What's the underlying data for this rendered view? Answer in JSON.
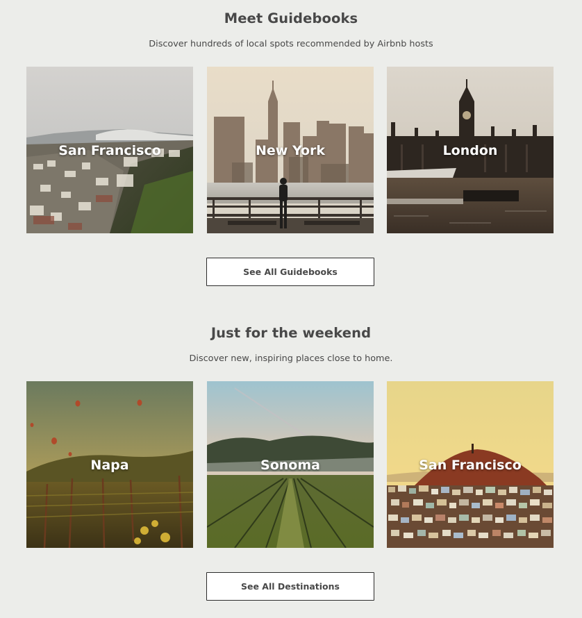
{
  "guidebooks": {
    "title": "Meet Guidebooks",
    "subtitle": "Discover hundreds of local spots recommended by Airbnb hosts",
    "cards": [
      {
        "label": "San Francisco"
      },
      {
        "label": "New York"
      },
      {
        "label": "London"
      }
    ],
    "button_label": "See All Guidebooks"
  },
  "weekend": {
    "title": "Just for the weekend",
    "subtitle": "Discover new, inspiring places close to home.",
    "cards": [
      {
        "label": "Napa"
      },
      {
        "label": "Sonoma"
      },
      {
        "label": "San Francisco"
      }
    ],
    "button_label": "See All Destinations"
  },
  "colors": {
    "background": "#ecedea",
    "text": "#484848",
    "button_border": "#2b2b2b"
  }
}
